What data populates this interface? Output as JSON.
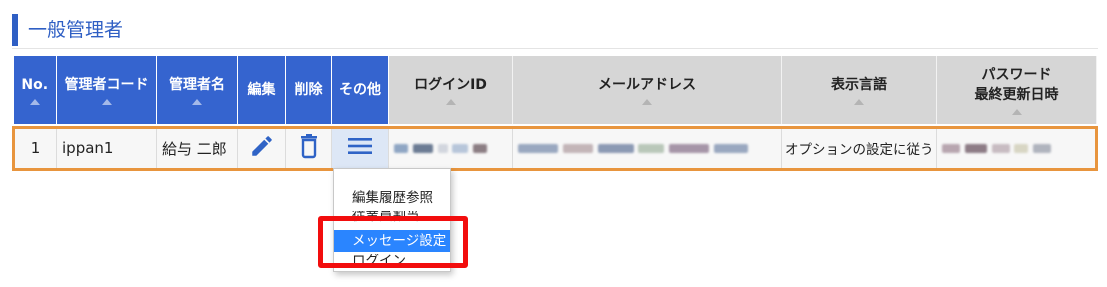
{
  "section": {
    "title": "一般管理者"
  },
  "table": {
    "headers": {
      "no": "No.",
      "code": "管理者コード",
      "name": "管理者名",
      "edit": "編集",
      "delete": "削除",
      "other": "その他",
      "login_id": "ログインID",
      "email": "メールアドレス",
      "language": "表示言語",
      "pw_line1": "パスワード",
      "pw_line2": "最終更新日時"
    },
    "rows": [
      {
        "no": "1",
        "code": "ippan1",
        "name": "給与 二郎",
        "language": "オプションの設定に従う"
      }
    ]
  },
  "dropdown": {
    "items": [
      "編集履歴参照",
      "従業員割当",
      "メッセージ設定",
      "ログイン"
    ],
    "selected_index": 2
  },
  "colors": {
    "header_blue": "#3564cf",
    "header_gray": "#d6d6d6",
    "row_outline": "#e8953e",
    "highlight_red": "#f20d0d",
    "menu_selected": "#2a85ff"
  },
  "icons": {
    "edit": "pencil-icon",
    "delete": "trash-icon",
    "other": "hamburger-menu-icon"
  }
}
